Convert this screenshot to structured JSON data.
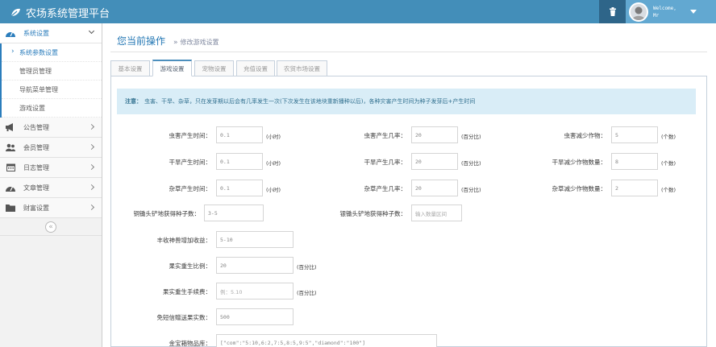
{
  "app": {
    "title": "农场系统管理平台"
  },
  "user": {
    "greeting": "Welcome,",
    "name": "Mr"
  },
  "sidebar": {
    "groups": [
      {
        "label": "系统设置",
        "icon": "dashboard-icon",
        "children": [
          "系统参数设置",
          "管理员管理",
          "导航菜单管理",
          "游戏设置"
        ]
      },
      {
        "label": "公告管理",
        "icon": "bullhorn-icon"
      },
      {
        "label": "会员管理",
        "icon": "users-icon"
      },
      {
        "label": "日志管理",
        "icon": "calendar-icon"
      },
      {
        "label": "文章管理",
        "icon": "speedometer-icon"
      },
      {
        "label": "财富设置",
        "icon": "folder-icon"
      }
    ],
    "collapse": "«"
  },
  "breadcrumb": {
    "main": "您当前操作",
    "sep": "»",
    "sub": "修改游戏设置"
  },
  "tabs": [
    "基本设置",
    "游戏设置",
    "宠物设置",
    "充值设置",
    "农贸市场设置"
  ],
  "notice": {
    "label": "注意：",
    "text": "虫害、干旱、杂草，只在发芽期以后会有几率发生一次(下次发生在该地块重新播种以后)，各种灾害产生时间为种子发芽后+产生时间"
  },
  "form": {
    "row1": [
      {
        "label": "虫害产生时间：",
        "value": "0.1",
        "unit": "(小时)"
      },
      {
        "label": "虫害产生几率：",
        "value": "20",
        "unit": "(百分比)"
      },
      {
        "label": "虫害减少作物：",
        "value": "5",
        "unit": "(个数)"
      }
    ],
    "row2": [
      {
        "label": "干旱产生时间：",
        "value": "0.1",
        "unit": "(小时)"
      },
      {
        "label": "干旱产生几率：",
        "value": "20",
        "unit": "(百分比)"
      },
      {
        "label": "干旱减少作物数量：",
        "value": "8",
        "unit": "(个数)"
      }
    ],
    "row3": [
      {
        "label": "杂草产生时间：",
        "value": "0.1",
        "unit": "(小时)"
      },
      {
        "label": "杂草产生几率：",
        "value": "20",
        "unit": "(百分比)"
      },
      {
        "label": "杂草减少作物数量：",
        "value": "2",
        "unit": "(个数)"
      }
    ],
    "row4": [
      {
        "label": "铜锄头铲地获得种子数：",
        "value": "3-5"
      },
      {
        "label": "银锄头铲地获得种子数：",
        "placeholder": "输入数量区间"
      }
    ],
    "harvest": {
      "label": "丰收神兽增加收益：",
      "value": "5-10"
    },
    "fruit_ratio": {
      "label": "果实重生比例：",
      "value": "20",
      "unit": "(百分比)"
    },
    "fruit_fee": {
      "label": "果实重生手续费：",
      "placeholder": "例：5.10",
      "unit": "(百分比)"
    },
    "sms_gift": {
      "label": "免短信赠送果实数：",
      "value": "500"
    },
    "treasure": {
      "label": "金宝箱物品库：",
      "value": "[\"com\":\"5:10,6:2,7:5,8:5,9:5\",\"diamond\":\"100\"]"
    }
  }
}
